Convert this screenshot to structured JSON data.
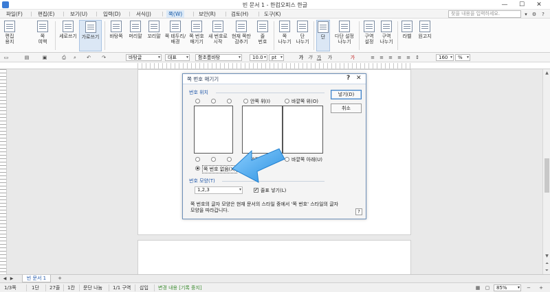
{
  "window": {
    "title": "빈 문서 1 - 한컴오피스 한글",
    "min": "—",
    "max": "☐",
    "close": "✕"
  },
  "menu": {
    "items": [
      "파일(F)",
      "편집(E)",
      "보기(U)",
      "입력(D)",
      "서식(J)",
      "쪽(W)",
      "보안(R)",
      "검토(H)",
      "도구(K)"
    ],
    "active": "쪽(W)",
    "help_placeholder": "찾을 내용을 입력하세요."
  },
  "ribbon": {
    "buttons": [
      {
        "label": "편집\n용지"
      },
      {
        "label": "쪽\n여백"
      },
      {
        "label": "세로쓰기"
      },
      {
        "label": "가로쓰기"
      },
      {
        "label": "바탕쪽"
      },
      {
        "label": "머리말"
      },
      {
        "label": "꼬리말"
      },
      {
        "label": "쪽 테두리/\n배경"
      },
      {
        "label": "쪽 번호\n매기기"
      },
      {
        "label": "새 번호로\n시작"
      },
      {
        "label": "현재 쪽만\n감추기"
      },
      {
        "label": "줄\n번호"
      },
      {
        "label": "쪽\n나누기"
      },
      {
        "label": "단\n나누기"
      },
      {
        "label": "단"
      },
      {
        "label": "다단 설정\n나누기"
      },
      {
        "label": "구역\n설정"
      },
      {
        "label": "구역\n나누기"
      },
      {
        "label": "라벨"
      },
      {
        "label": "원고지"
      }
    ]
  },
  "format": {
    "style": "바탕글",
    "lang": "대표",
    "font": "함초롬바탕",
    "size": "10.0",
    "size_unit": "pt",
    "zoom": "160",
    "zoom_unit": "%"
  },
  "dialog": {
    "title": "쪽 번호 매기기",
    "help_glyph": "?",
    "close_glyph": "✕",
    "position_label": "번호 위치",
    "opt_inside_top": "안쪽 위(I)",
    "opt_outside_top": "바깥쪽 위(O)",
    "opt_inside_bottom": "안쪽 아래(N)",
    "opt_outside_bottom": "바깥쪽 아래(U)",
    "opt_none": "쪽 번호 없음(X)",
    "shape_label": "번호 모양(T)",
    "shape_value": "1,2,3",
    "dash_label": "줄표 넣기(L)",
    "dash_checked": "✔",
    "ok": "넣기(D)",
    "cancel": "취소",
    "note": "쪽 번호의 글자 모양은 현재 문서의 스타일 중에서 '쪽 번호' 스타일의 글자 모양을 따라갑니다.",
    "note_help": "?"
  },
  "tabs": {
    "doc": "빈 문서 1",
    "add": "+"
  },
  "status": {
    "page": "1/3쪽",
    "section": "1단",
    "line": "27줄",
    "col": "1칸",
    "break": "문단 나눔",
    "zone": "1/1 구역",
    "mode": "삽입",
    "track": "변경 내용 [기록 중지]",
    "zoom": "85%",
    "zoom_minus": "−",
    "zoom_plus": "+"
  },
  "colors": {
    "accent": "#1f56a8",
    "arrow": "#3b9fe8"
  }
}
